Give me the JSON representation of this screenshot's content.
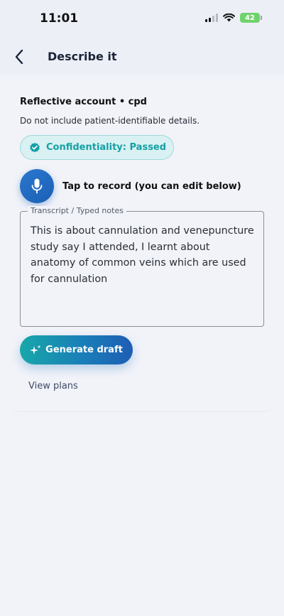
{
  "status": {
    "time": "11:01",
    "battery": "42"
  },
  "nav": {
    "title": "Describe it"
  },
  "form": {
    "heading": "Reflective account • cpd",
    "subtitle": "Do not include patient-identifiable details.",
    "confidentiality_badge": "Confidentiality: Passed",
    "record_label": "Tap to record (you can edit below)",
    "transcript_label": "Transcript / Typed notes",
    "transcript_value": "This is about cannulation and venepuncture study say I attended, I learnt about anatomy of common veins which are used for cannulation",
    "generate_label": "Generate draft",
    "view_plans_label": "View plans"
  },
  "colors": {
    "accent_teal": "#14a0a6",
    "accent_blue": "#1e5db4",
    "badge_bg": "#d9f1f2"
  },
  "icons": {
    "back": "chevron-left-icon",
    "badge": "check-badge-icon",
    "mic": "microphone-icon",
    "generate": "sparkle-icon"
  }
}
